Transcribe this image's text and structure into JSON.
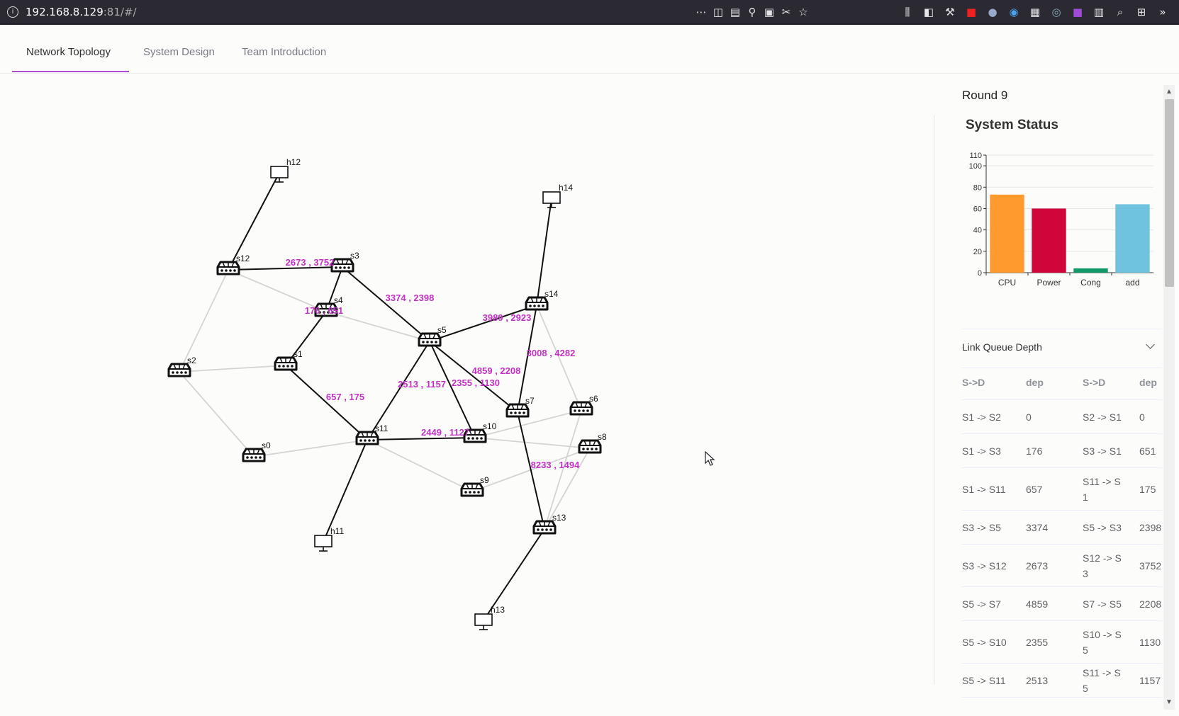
{
  "browser": {
    "url_host": "192.168.8.129",
    "url_rest": ":81/#/"
  },
  "tabs": [
    {
      "label": "Network Topology",
      "active": true
    },
    {
      "label": "System Design",
      "active": false
    },
    {
      "label": "Team Introduction",
      "active": false
    }
  ],
  "topology": {
    "nodes": [
      {
        "id": "s0",
        "kind": "switch"
      },
      {
        "id": "s1",
        "kind": "switch"
      },
      {
        "id": "s2",
        "kind": "switch"
      },
      {
        "id": "s3",
        "kind": "switch"
      },
      {
        "id": "s4",
        "kind": "switch"
      },
      {
        "id": "s5",
        "kind": "switch"
      },
      {
        "id": "s6",
        "kind": "switch"
      },
      {
        "id": "s7",
        "kind": "switch"
      },
      {
        "id": "s8",
        "kind": "switch"
      },
      {
        "id": "s9",
        "kind": "switch"
      },
      {
        "id": "s10",
        "kind": "switch"
      },
      {
        "id": "s11",
        "kind": "switch"
      },
      {
        "id": "s12",
        "kind": "switch"
      },
      {
        "id": "s13",
        "kind": "switch"
      },
      {
        "id": "s14",
        "kind": "switch"
      },
      {
        "id": "h11",
        "kind": "host"
      },
      {
        "id": "h12",
        "kind": "host"
      },
      {
        "id": "h13",
        "kind": "host"
      },
      {
        "id": "h14",
        "kind": "host"
      }
    ],
    "active_links": [
      {
        "a": "h12",
        "b": "s12",
        "label": ""
      },
      {
        "a": "s12",
        "b": "s3",
        "label": "2673 , 3752"
      },
      {
        "a": "s3",
        "b": "s5",
        "label": "3374 , 2398"
      },
      {
        "a": "s3",
        "b": "s4",
        "label": ""
      },
      {
        "a": "s4",
        "b": "s1",
        "label": "176 , 651"
      },
      {
        "a": "s1",
        "b": "s11",
        "label": "657 , 175"
      },
      {
        "a": "s11",
        "b": "s5",
        "label": "2513 , 1157"
      },
      {
        "a": "s5",
        "b": "s10",
        "label": "2355 , 1130"
      },
      {
        "a": "s5",
        "b": "s7",
        "label": "4859 , 2208"
      },
      {
        "a": "s5",
        "b": "s14",
        "label": "3989 , 2923"
      },
      {
        "a": "s14",
        "b": "s7",
        "label": "3008 , 4282"
      },
      {
        "a": "s14",
        "b": "h14",
        "label": ""
      },
      {
        "a": "s11",
        "b": "s10",
        "label": "2449 , 1127"
      },
      {
        "a": "s7",
        "b": "s13",
        "label": "8233 , 1494"
      },
      {
        "a": "s11",
        "b": "h11",
        "label": ""
      },
      {
        "a": "s13",
        "b": "h13",
        "label": ""
      }
    ],
    "idle_links": [
      {
        "a": "s12",
        "b": "s4"
      },
      {
        "a": "s12",
        "b": "s2"
      },
      {
        "a": "s4",
        "b": "s5"
      },
      {
        "a": "s2",
        "b": "s1"
      },
      {
        "a": "s2",
        "b": "s0"
      },
      {
        "a": "s0",
        "b": "s11"
      },
      {
        "a": "s11",
        "b": "s9"
      },
      {
        "a": "s10",
        "b": "s8"
      },
      {
        "a": "s10",
        "b": "s6"
      },
      {
        "a": "s9",
        "b": "s8"
      },
      {
        "a": "s14",
        "b": "s6"
      },
      {
        "a": "s6",
        "b": "s13"
      },
      {
        "a": "s8",
        "b": "s13"
      }
    ]
  },
  "side": {
    "round": "Round 9",
    "system_status_title": "System Status",
    "link_queue_title": "Link Queue Depth",
    "table": {
      "headers": [
        "S->D",
        "dep",
        "S->D",
        "dep"
      ],
      "rows": [
        [
          "S1 -> S2",
          "0",
          "S2 -> S1",
          "0"
        ],
        [
          "S1 -> S3",
          "176",
          "S3 -> S1",
          "651"
        ],
        [
          "S1 -> S11",
          "657",
          "S11 -> S 1",
          "175"
        ],
        [
          "S3 -> S5",
          "3374",
          "S5 -> S3",
          "2398"
        ],
        [
          "S3 -> S12",
          "2673",
          "S12 -> S 3",
          "3752"
        ],
        [
          "S5 -> S7",
          "4859",
          "S7 -> S5",
          "2208"
        ],
        [
          "S5 -> S10",
          "2355",
          "S10 -> S 5",
          "1130"
        ],
        [
          "S5 -> S11",
          "2513",
          "S11 -> S 5",
          "1157"
        ]
      ]
    }
  },
  "chart_data": {
    "type": "bar",
    "categories": [
      "CPU",
      "Power",
      "Cong",
      "add"
    ],
    "values": [
      73,
      60,
      4,
      64
    ],
    "colors": [
      "#ff9a2e",
      "#d0053a",
      "#139a6a",
      "#70c3de"
    ],
    "yticks": [
      0,
      20,
      40,
      60,
      80,
      100,
      110
    ],
    "ylim": [
      0,
      110
    ],
    "grid": true,
    "title": "",
    "xlabel": "",
    "ylabel": ""
  }
}
